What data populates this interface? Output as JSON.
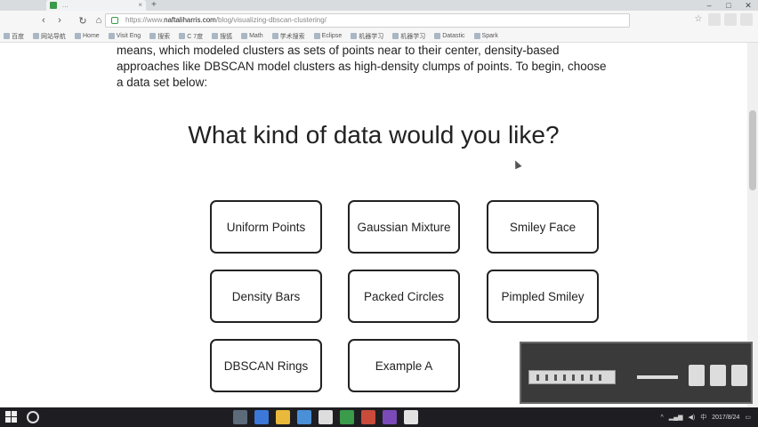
{
  "browser": {
    "tab_title": "...",
    "tab_close": "×",
    "new_tab": "+",
    "url_scheme": "https://www.",
    "url_host": "naftaliharris.com",
    "url_path": "/blog/visualizing-dbscan-clustering/",
    "bookmarks": [
      "百度",
      "网站导航",
      "Home",
      "Visit Eng",
      "搜索",
      "C 7度",
      "搜狐",
      "Math",
      "学术搜索",
      "Eclipse",
      "机器学习",
      "机器学习",
      "Datastic",
      "Spark"
    ]
  },
  "page": {
    "intro_text": "means, which modeled clusters as sets of points near to their center, density-based approaches like DBSCAN model clusters as high-density clumps of points. To begin, choose a data set below:",
    "heading": "What kind of data would you like?",
    "buttons": [
      "Uniform Points",
      "Gaussian Mixture",
      "Smiley Face",
      "Density Bars",
      "Packed Circles",
      "Pimpled Smiley",
      "DBSCAN Rings",
      "Example A"
    ]
  },
  "taskbar": {
    "cortana_text": "",
    "clock_time": "",
    "clock_date": "2017/8/24",
    "ime": "中"
  },
  "colors": {
    "border": "#222222",
    "taskbar": "#1e1e22"
  }
}
